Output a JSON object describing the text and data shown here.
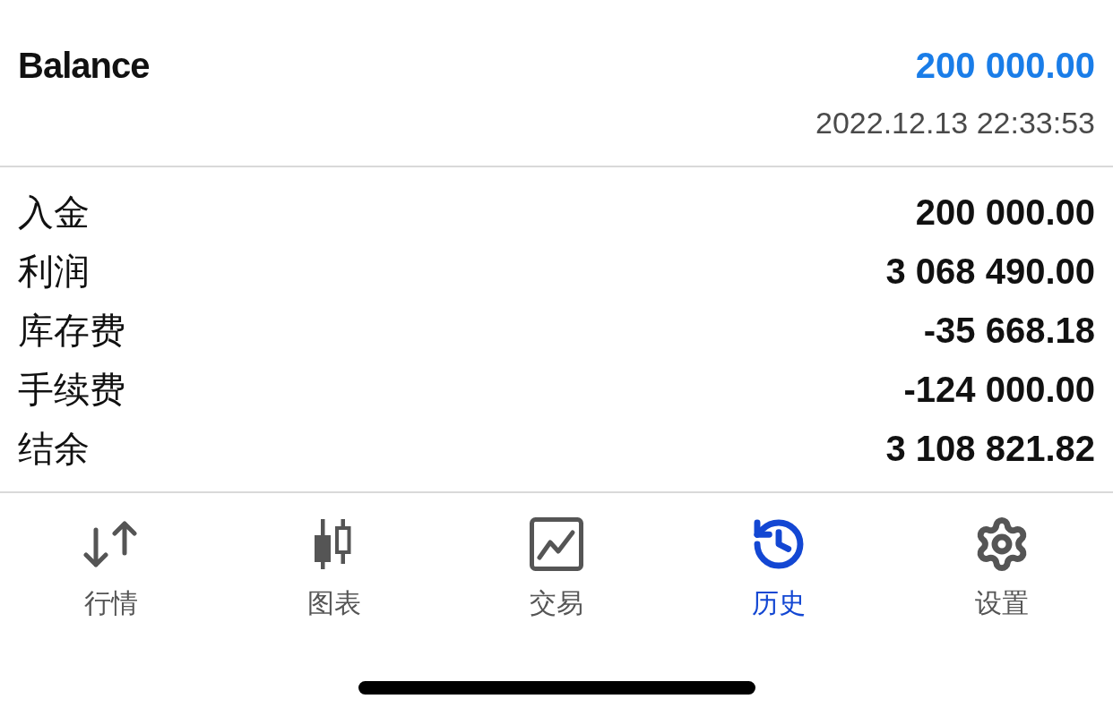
{
  "header": {
    "title": "Balance",
    "amount": "200 000.00",
    "timestamp": "2022.12.13 22:33:53"
  },
  "rows": [
    {
      "label": "入金",
      "value": "200 000.00"
    },
    {
      "label": "利润",
      "value": "3 068 490.00"
    },
    {
      "label": "库存费",
      "value": "-35 668.18"
    },
    {
      "label": "手续费",
      "value": "-124 000.00"
    },
    {
      "label": "结余",
      "value": "3 108 821.82"
    }
  ],
  "tab_bar": [
    {
      "kind": "quotes",
      "label": "行情",
      "selected": false
    },
    {
      "kind": "chart",
      "label": "图表",
      "selected": false
    },
    {
      "kind": "trade",
      "label": "交易",
      "selected": false
    },
    {
      "kind": "history",
      "label": "历史",
      "selected": true
    },
    {
      "kind": "settings",
      "label": "设置",
      "selected": false
    }
  ]
}
